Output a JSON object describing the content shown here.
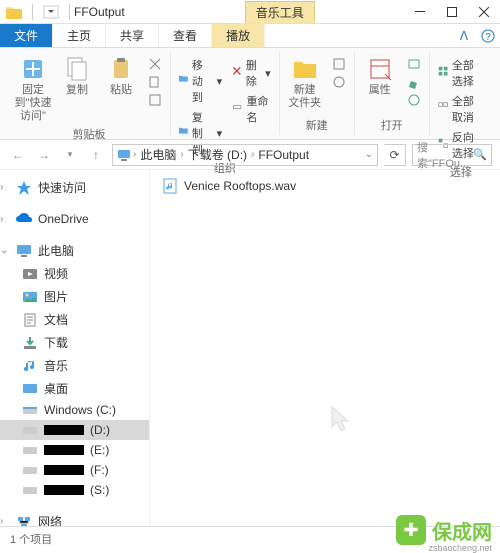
{
  "titlebar": {
    "title": "FFOutput",
    "music_tab": "音乐工具"
  },
  "tabs": {
    "file": "文件",
    "home": "主页",
    "share": "共享",
    "view": "查看",
    "play": "播放"
  },
  "ribbon": {
    "clipboard": {
      "pin": "固定到\"快速访问\"",
      "copy": "复制",
      "paste": "粘贴",
      "label": "剪贴板"
    },
    "organize": {
      "moveto": "移动到",
      "copyto": "复制到",
      "delete": "删除",
      "rename": "重命名",
      "label": "组织"
    },
    "new": {
      "newfolder": "新建\n文件夹",
      "label": "新建"
    },
    "open": {
      "props": "属性",
      "label": "打开"
    },
    "select": {
      "selectall": "全部选择",
      "selectnone": "全部取消",
      "invert": "反向选择",
      "label": "选择"
    }
  },
  "address": {
    "root": "此电脑",
    "drive": "下载卷 (D:)",
    "folder": "FFOutput"
  },
  "search": {
    "placeholder": "搜索\"FFOu..."
  },
  "sidebar": {
    "quick": "快速访问",
    "onedrive": "OneDrive",
    "pc": "此电脑",
    "videos": "视频",
    "pictures": "图片",
    "documents": "文档",
    "downloads": "下载",
    "music": "音乐",
    "desktop": "桌面",
    "winc": "Windows (C:)",
    "d": "(D:)",
    "e": "(E:)",
    "f": "(F:)",
    "s": "(S:)",
    "network": "网络"
  },
  "files": {
    "item1": "Venice Rooftops.wav"
  },
  "status": {
    "count": "1 个项目"
  },
  "watermark": {
    "text": "保成网",
    "url": "zsbaocheng.net"
  }
}
